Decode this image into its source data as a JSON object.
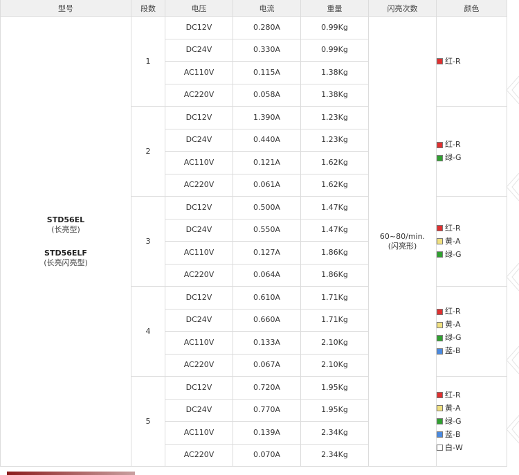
{
  "headers": {
    "model": "型号",
    "segments": "段数",
    "voltage": "电压",
    "current": "电流",
    "weight": "重量",
    "flash": "闪亮次数",
    "color": "颜色"
  },
  "model": {
    "name1": "STD56EL",
    "sub1": "(长亮型)",
    "name2": "STD56ELF",
    "sub2": "(长亮闪亮型)"
  },
  "flash": {
    "rate": "60~80/min.",
    "note": "(闪亮形)"
  },
  "color_palette": {
    "red": "#e03030",
    "amber": "#f0e080",
    "green": "#30a030",
    "blue": "#4a8ae0",
    "white": "#ffffff"
  },
  "groups": [
    {
      "segments": "1",
      "colors": [
        {
          "label": "红-R",
          "swatch": "red"
        }
      ],
      "rows": [
        {
          "voltage": "DC12V",
          "current": "0.280A",
          "weight": "0.99Kg"
        },
        {
          "voltage": "DC24V",
          "current": "0.330A",
          "weight": "0.99Kg"
        },
        {
          "voltage": "AC110V",
          "current": "0.115A",
          "weight": "1.38Kg"
        },
        {
          "voltage": "AC220V",
          "current": "0.058A",
          "weight": "1.38Kg"
        }
      ]
    },
    {
      "segments": "2",
      "colors": [
        {
          "label": "红-R",
          "swatch": "red"
        },
        {
          "label": "绿-G",
          "swatch": "green"
        }
      ],
      "rows": [
        {
          "voltage": "DC12V",
          "current": "1.390A",
          "weight": "1.23Kg"
        },
        {
          "voltage": "DC24V",
          "current": "0.440A",
          "weight": "1.23Kg"
        },
        {
          "voltage": "AC110V",
          "current": "0.121A",
          "weight": "1.62Kg"
        },
        {
          "voltage": "AC220V",
          "current": "0.061A",
          "weight": "1.62Kg"
        }
      ]
    },
    {
      "segments": "3",
      "colors": [
        {
          "label": "红-R",
          "swatch": "red"
        },
        {
          "label": "黄-A",
          "swatch": "amber"
        },
        {
          "label": "绿-G",
          "swatch": "green"
        }
      ],
      "rows": [
        {
          "voltage": "DC12V",
          "current": "0.500A",
          "weight": "1.47Kg"
        },
        {
          "voltage": "DC24V",
          "current": "0.550A",
          "weight": "1.47Kg"
        },
        {
          "voltage": "AC110V",
          "current": "0.127A",
          "weight": "1.86Kg"
        },
        {
          "voltage": "AC220V",
          "current": "0.064A",
          "weight": "1.86Kg"
        }
      ]
    },
    {
      "segments": "4",
      "colors": [
        {
          "label": "红-R",
          "swatch": "red"
        },
        {
          "label": "黄-A",
          "swatch": "amber"
        },
        {
          "label": "绿-G",
          "swatch": "green"
        },
        {
          "label": "蓝-B",
          "swatch": "blue"
        }
      ],
      "rows": [
        {
          "voltage": "DC12V",
          "current": "0.610A",
          "weight": "1.71Kg"
        },
        {
          "voltage": "DC24V",
          "current": "0.660A",
          "weight": "1.71Kg"
        },
        {
          "voltage": "AC110V",
          "current": "0.133A",
          "weight": "2.10Kg"
        },
        {
          "voltage": "AC220V",
          "current": "0.067A",
          "weight": "2.10Kg"
        }
      ]
    },
    {
      "segments": "5",
      "colors": [
        {
          "label": "红-R",
          "swatch": "red"
        },
        {
          "label": "黄-A",
          "swatch": "amber"
        },
        {
          "label": "绿-G",
          "swatch": "green"
        },
        {
          "label": "蓝-B",
          "swatch": "blue"
        },
        {
          "label": "白-W",
          "swatch": "white"
        }
      ],
      "rows": [
        {
          "voltage": "DC12V",
          "current": "0.720A",
          "weight": "1.95Kg"
        },
        {
          "voltage": "DC24V",
          "current": "0.770A",
          "weight": "1.95Kg"
        },
        {
          "voltage": "AC110V",
          "current": "0.139A",
          "weight": "2.34Kg"
        },
        {
          "voltage": "AC220V",
          "current": "0.070A",
          "weight": "2.34Kg"
        }
      ]
    }
  ]
}
